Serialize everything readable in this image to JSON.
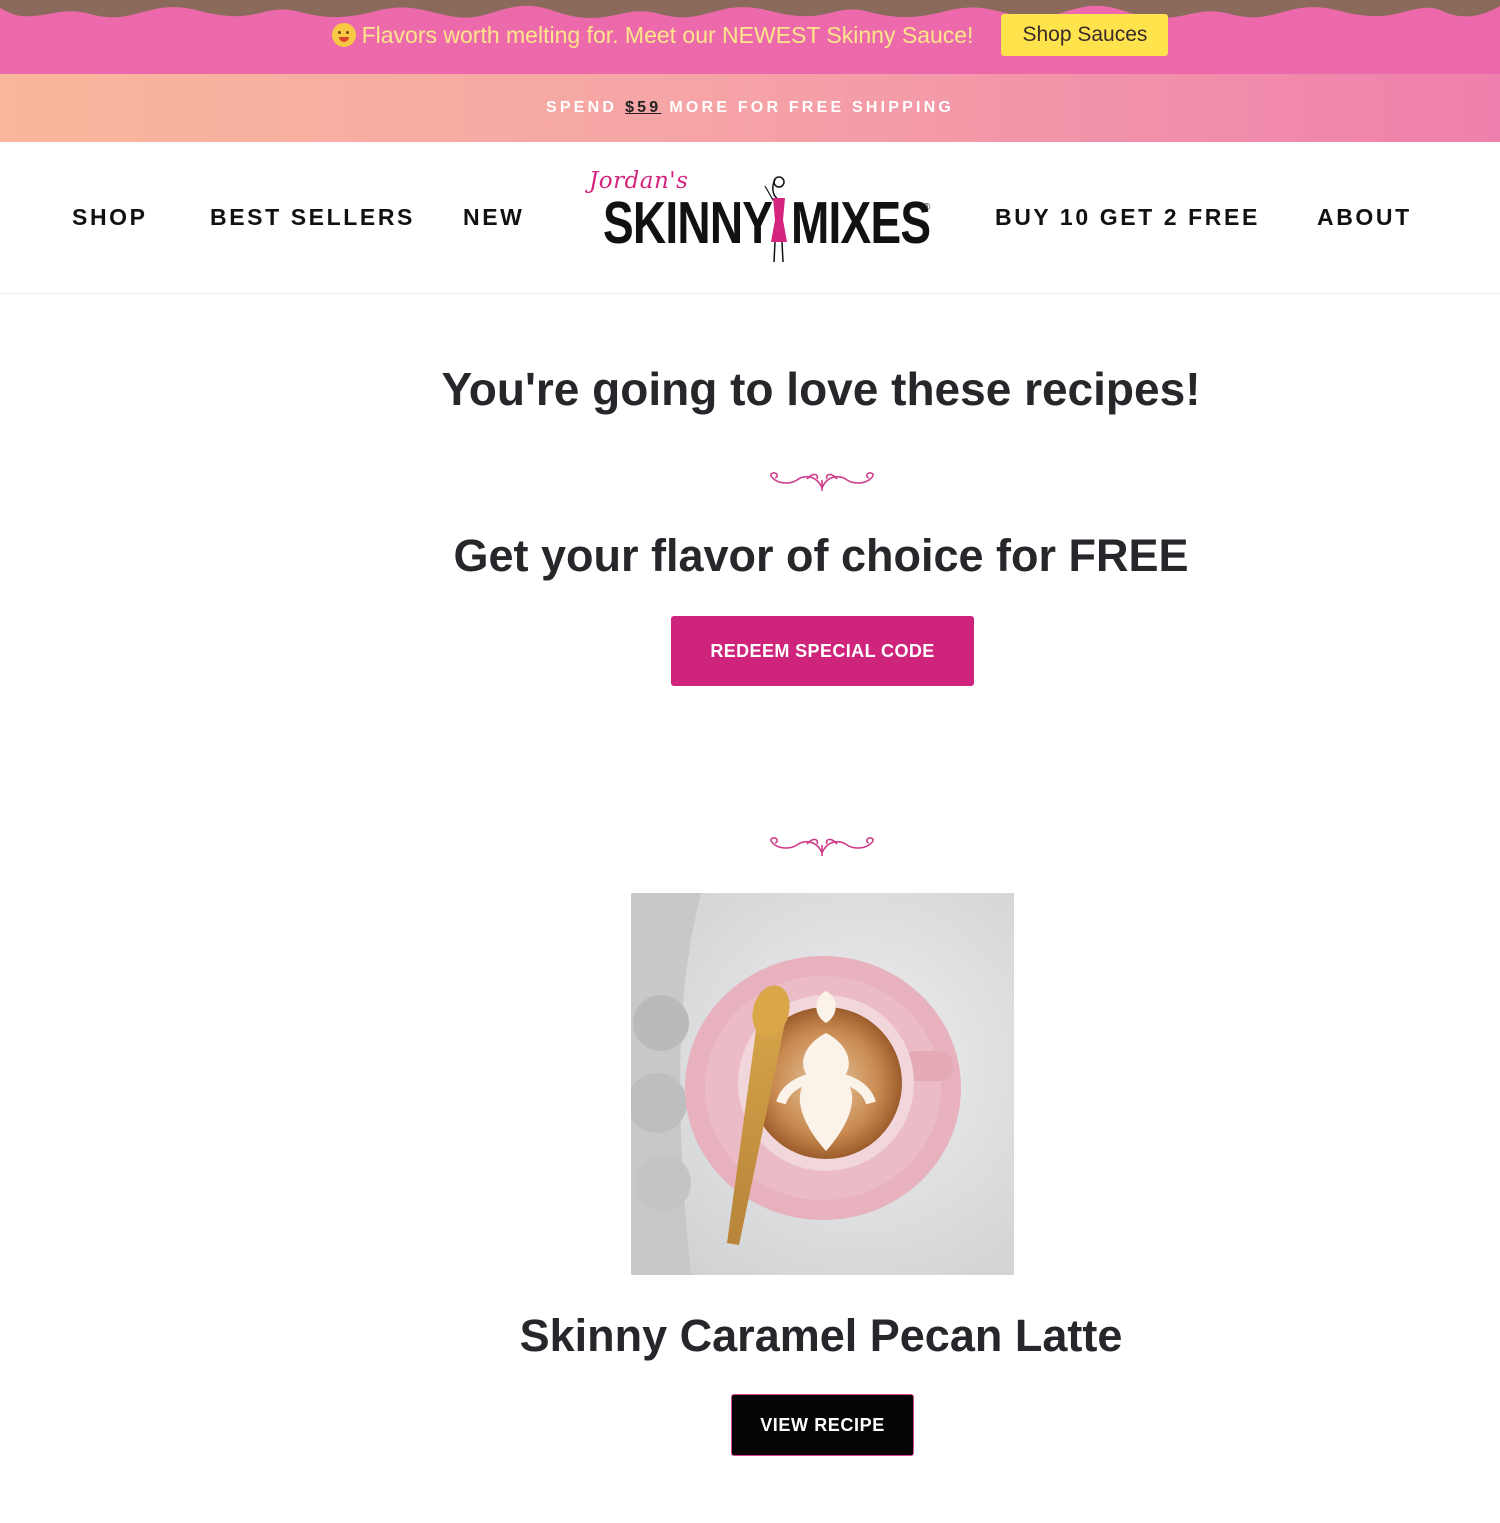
{
  "promo": {
    "emoji_icon": "melting-face-icon",
    "text": "Flavors worth melting for. Meet our NEWEST Skinny Sauce!",
    "button_label": "Shop Sauces",
    "colors": {
      "background": "#ec6aab",
      "text": "#ffe68a",
      "button": "#ffe34d"
    }
  },
  "shipping": {
    "prefix": "SPEND",
    "amount": "$59",
    "suffix": "MORE FOR FREE SHIPPING"
  },
  "nav": {
    "left": [
      "SHOP",
      "BEST SELLERS",
      "NEW"
    ],
    "right": [
      "BUY 10 GET 2 FREE",
      "ABOUT"
    ]
  },
  "logo": {
    "script": "Jordan's",
    "word_left": "SKINNY",
    "word_right": "MIXES",
    "registered": "®"
  },
  "main": {
    "heading": "You're going to love these recipes!",
    "subheading": "Get your flavor of choice for FREE",
    "redeem_label": "REDEEM SPECIAL CODE",
    "flourish_icon": "flourish-divider-icon"
  },
  "recipe": {
    "title": "Skinny Caramel Pecan Latte",
    "button_label": "VIEW RECIPE",
    "image": "latte-art-pink-cup-photo"
  },
  "colors": {
    "accent": "#cf247c",
    "text_dark": "#27272b"
  }
}
